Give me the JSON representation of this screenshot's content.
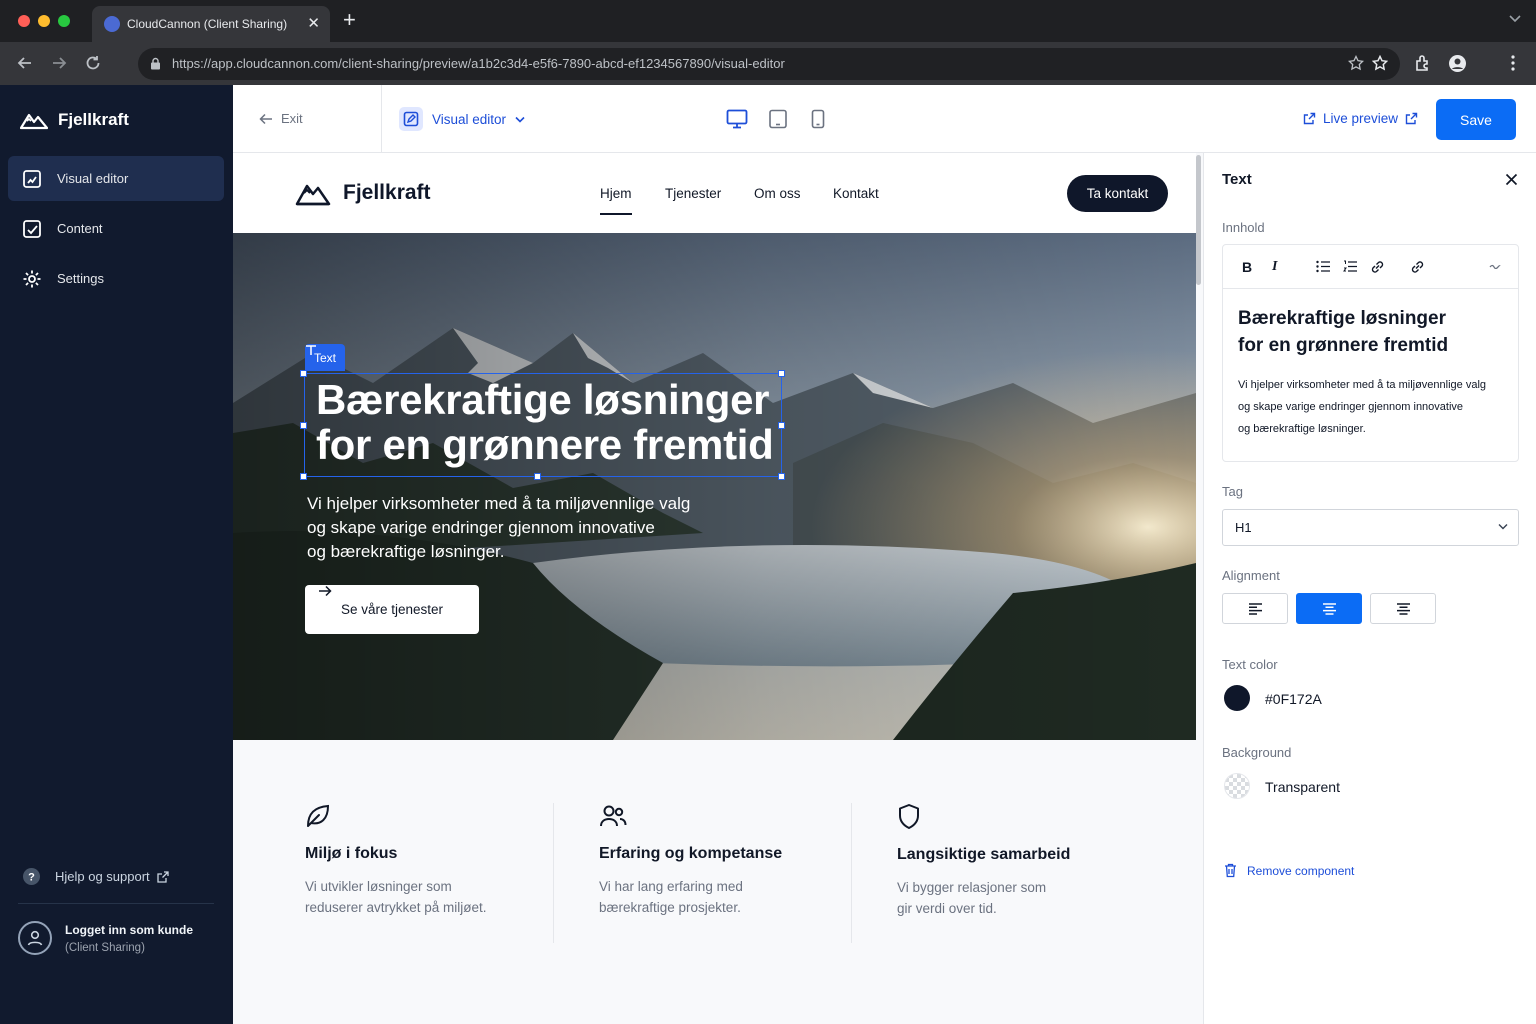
{
  "browser": {
    "tab_title": "CloudCannon (Client Sharing)",
    "url": "https://app.cloudcannon.com/client-sharing/preview/a1b2c3d4-e5f6-7890-abcd-ef1234567890/visual-editor"
  },
  "sidebar": {
    "brand": "Fjellkraft",
    "items": [
      {
        "label": "Visual editor",
        "icon": "visual-editor-icon",
        "active": true
      },
      {
        "label": "Content",
        "icon": "content-icon",
        "active": false
      },
      {
        "label": "Settings",
        "icon": "gear-icon",
        "active": false
      }
    ],
    "help": "Hjelp og support",
    "user_line1": "Logget inn som kunde",
    "user_line2": "(Client Sharing)"
  },
  "topbar": {
    "exit": "Exit",
    "mode": "Visual editor",
    "live_preview": "Live preview",
    "save": "Save"
  },
  "site": {
    "brand": "Fjellkraft",
    "nav": [
      "Hjem",
      "Tjenester",
      "Om oss",
      "Kontakt"
    ],
    "cta": "Ta kontakt",
    "hero": {
      "selection_tag": "Text",
      "title_line1": "Bærekraftige løsninger",
      "title_line2": "for en grønnere fremtid",
      "subtitle_line1": "Vi hjelper virksomheter med å ta miljøvennlige valg",
      "subtitle_line2": "og skape varige endringer gjennom innovative",
      "subtitle_line3": "og bærekraftige løsninger.",
      "button": "Se våre tjenester"
    },
    "features": [
      {
        "icon": "leaf-icon",
        "title": "Miljø i fokus",
        "line1": "Vi utvikler løsninger som",
        "line2": "reduserer avtrykket på miljøet."
      },
      {
        "icon": "users-icon",
        "title": "Erfaring og kompetanse",
        "line1": "Vi har lang erfaring med",
        "line2": "bærekraftige prosjekter."
      },
      {
        "icon": "shield-icon",
        "title": "Langsiktige samarbeid",
        "line1": "Vi bygger relasjoner som",
        "line2": "gir verdi over tid."
      }
    ]
  },
  "panel": {
    "title": "Text",
    "content_label": "Innhold",
    "editor_heading_line1": "Bærekraftige løsninger",
    "editor_heading_line2": "for en grønnere fremtid",
    "editor_p_line1": "Vi hjelper virksomheter med å ta miljøvennlige valg",
    "editor_p_line2": "og skape varige endringer gjennom innovative",
    "editor_p_line3": "og bærekraftige løsninger.",
    "tag_label": "Tag",
    "tag_value": "H1",
    "alignment_label": "Alignment",
    "alignment_selected": "center",
    "text_color_label": "Text color",
    "text_color_value": "#0F172A",
    "background_label": "Background",
    "background_value": "Transparent",
    "remove": "Remove component"
  },
  "colors": {
    "accent": "#0B6CF5",
    "sidebar": "#111A2E",
    "text_dark": "#0F172A"
  }
}
